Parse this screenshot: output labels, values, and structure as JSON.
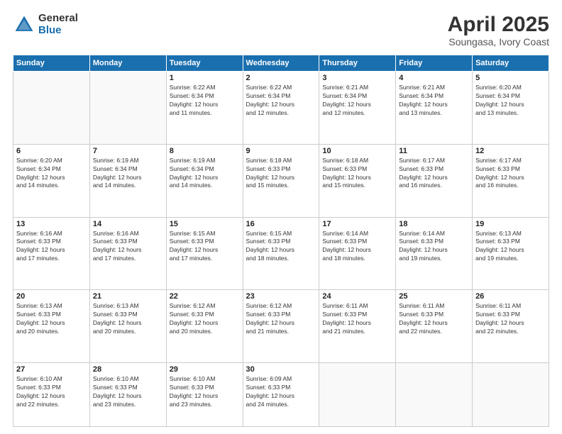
{
  "logo": {
    "general": "General",
    "blue": "Blue"
  },
  "header": {
    "title": "April 2025",
    "subtitle": "Soungasa, Ivory Coast"
  },
  "weekdays": [
    "Sunday",
    "Monday",
    "Tuesday",
    "Wednesday",
    "Thursday",
    "Friday",
    "Saturday"
  ],
  "weeks": [
    [
      {
        "day": "",
        "info": ""
      },
      {
        "day": "",
        "info": ""
      },
      {
        "day": "1",
        "info": "Sunrise: 6:22 AM\nSunset: 6:34 PM\nDaylight: 12 hours\nand 11 minutes."
      },
      {
        "day": "2",
        "info": "Sunrise: 6:22 AM\nSunset: 6:34 PM\nDaylight: 12 hours\nand 12 minutes."
      },
      {
        "day": "3",
        "info": "Sunrise: 6:21 AM\nSunset: 6:34 PM\nDaylight: 12 hours\nand 12 minutes."
      },
      {
        "day": "4",
        "info": "Sunrise: 6:21 AM\nSunset: 6:34 PM\nDaylight: 12 hours\nand 13 minutes."
      },
      {
        "day": "5",
        "info": "Sunrise: 6:20 AM\nSunset: 6:34 PM\nDaylight: 12 hours\nand 13 minutes."
      }
    ],
    [
      {
        "day": "6",
        "info": "Sunrise: 6:20 AM\nSunset: 6:34 PM\nDaylight: 12 hours\nand 14 minutes."
      },
      {
        "day": "7",
        "info": "Sunrise: 6:19 AM\nSunset: 6:34 PM\nDaylight: 12 hours\nand 14 minutes."
      },
      {
        "day": "8",
        "info": "Sunrise: 6:19 AM\nSunset: 6:34 PM\nDaylight: 12 hours\nand 14 minutes."
      },
      {
        "day": "9",
        "info": "Sunrise: 6:18 AM\nSunset: 6:33 PM\nDaylight: 12 hours\nand 15 minutes."
      },
      {
        "day": "10",
        "info": "Sunrise: 6:18 AM\nSunset: 6:33 PM\nDaylight: 12 hours\nand 15 minutes."
      },
      {
        "day": "11",
        "info": "Sunrise: 6:17 AM\nSunset: 6:33 PM\nDaylight: 12 hours\nand 16 minutes."
      },
      {
        "day": "12",
        "info": "Sunrise: 6:17 AM\nSunset: 6:33 PM\nDaylight: 12 hours\nand 16 minutes."
      }
    ],
    [
      {
        "day": "13",
        "info": "Sunrise: 6:16 AM\nSunset: 6:33 PM\nDaylight: 12 hours\nand 17 minutes."
      },
      {
        "day": "14",
        "info": "Sunrise: 6:16 AM\nSunset: 6:33 PM\nDaylight: 12 hours\nand 17 minutes."
      },
      {
        "day": "15",
        "info": "Sunrise: 6:15 AM\nSunset: 6:33 PM\nDaylight: 12 hours\nand 17 minutes."
      },
      {
        "day": "16",
        "info": "Sunrise: 6:15 AM\nSunset: 6:33 PM\nDaylight: 12 hours\nand 18 minutes."
      },
      {
        "day": "17",
        "info": "Sunrise: 6:14 AM\nSunset: 6:33 PM\nDaylight: 12 hours\nand 18 minutes."
      },
      {
        "day": "18",
        "info": "Sunrise: 6:14 AM\nSunset: 6:33 PM\nDaylight: 12 hours\nand 19 minutes."
      },
      {
        "day": "19",
        "info": "Sunrise: 6:13 AM\nSunset: 6:33 PM\nDaylight: 12 hours\nand 19 minutes."
      }
    ],
    [
      {
        "day": "20",
        "info": "Sunrise: 6:13 AM\nSunset: 6:33 PM\nDaylight: 12 hours\nand 20 minutes."
      },
      {
        "day": "21",
        "info": "Sunrise: 6:13 AM\nSunset: 6:33 PM\nDaylight: 12 hours\nand 20 minutes."
      },
      {
        "day": "22",
        "info": "Sunrise: 6:12 AM\nSunset: 6:33 PM\nDaylight: 12 hours\nand 20 minutes."
      },
      {
        "day": "23",
        "info": "Sunrise: 6:12 AM\nSunset: 6:33 PM\nDaylight: 12 hours\nand 21 minutes."
      },
      {
        "day": "24",
        "info": "Sunrise: 6:11 AM\nSunset: 6:33 PM\nDaylight: 12 hours\nand 21 minutes."
      },
      {
        "day": "25",
        "info": "Sunrise: 6:11 AM\nSunset: 6:33 PM\nDaylight: 12 hours\nand 22 minutes."
      },
      {
        "day": "26",
        "info": "Sunrise: 6:11 AM\nSunset: 6:33 PM\nDaylight: 12 hours\nand 22 minutes."
      }
    ],
    [
      {
        "day": "27",
        "info": "Sunrise: 6:10 AM\nSunset: 6:33 PM\nDaylight: 12 hours\nand 22 minutes."
      },
      {
        "day": "28",
        "info": "Sunrise: 6:10 AM\nSunset: 6:33 PM\nDaylight: 12 hours\nand 23 minutes."
      },
      {
        "day": "29",
        "info": "Sunrise: 6:10 AM\nSunset: 6:33 PM\nDaylight: 12 hours\nand 23 minutes."
      },
      {
        "day": "30",
        "info": "Sunrise: 6:09 AM\nSunset: 6:33 PM\nDaylight: 12 hours\nand 24 minutes."
      },
      {
        "day": "",
        "info": ""
      },
      {
        "day": "",
        "info": ""
      },
      {
        "day": "",
        "info": ""
      }
    ]
  ]
}
